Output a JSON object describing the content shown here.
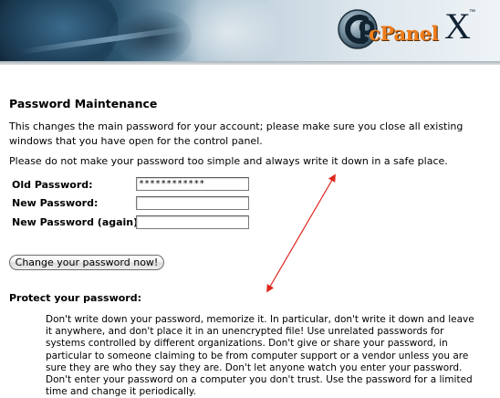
{
  "header": {
    "logo_text": "cPanel",
    "version_mark": "X",
    "trademark": "™"
  },
  "page": {
    "title": "Password Maintenance",
    "intro": "This changes the main password for your account; please make sure you close all existing windows that you have open for the control panel.",
    "warning": "Please do not make your password too simple and always write it down in a safe place."
  },
  "form": {
    "old_password": {
      "label": "Old Password:",
      "value": "************"
    },
    "new_password": {
      "label": "New Password:",
      "value": ""
    },
    "new_password_again": {
      "label": "New Password (again):",
      "value": ""
    },
    "submit_label": "Change your password now!"
  },
  "protect": {
    "heading": "Protect your password:",
    "body": "Don't write down your password, memorize it. In particular, don't write it down and leave it anywhere, and don't place it in an unencrypted file! Use unrelated passwords for systems controlled by different organizations. Don't give or share your password, in particular to someone claiming to be from computer support or a vendor unless you are sure they are who they say they are. Don't let anyone watch you enter your password. Don't enter your password on a computer you don't trust. Use the password for a limited time and change it periodically."
  },
  "colors": {
    "brand_orange": "#f07e1c",
    "annotation_red": "#e0261e"
  },
  "icons": {
    "logo": "cpanel-logo-icon"
  }
}
